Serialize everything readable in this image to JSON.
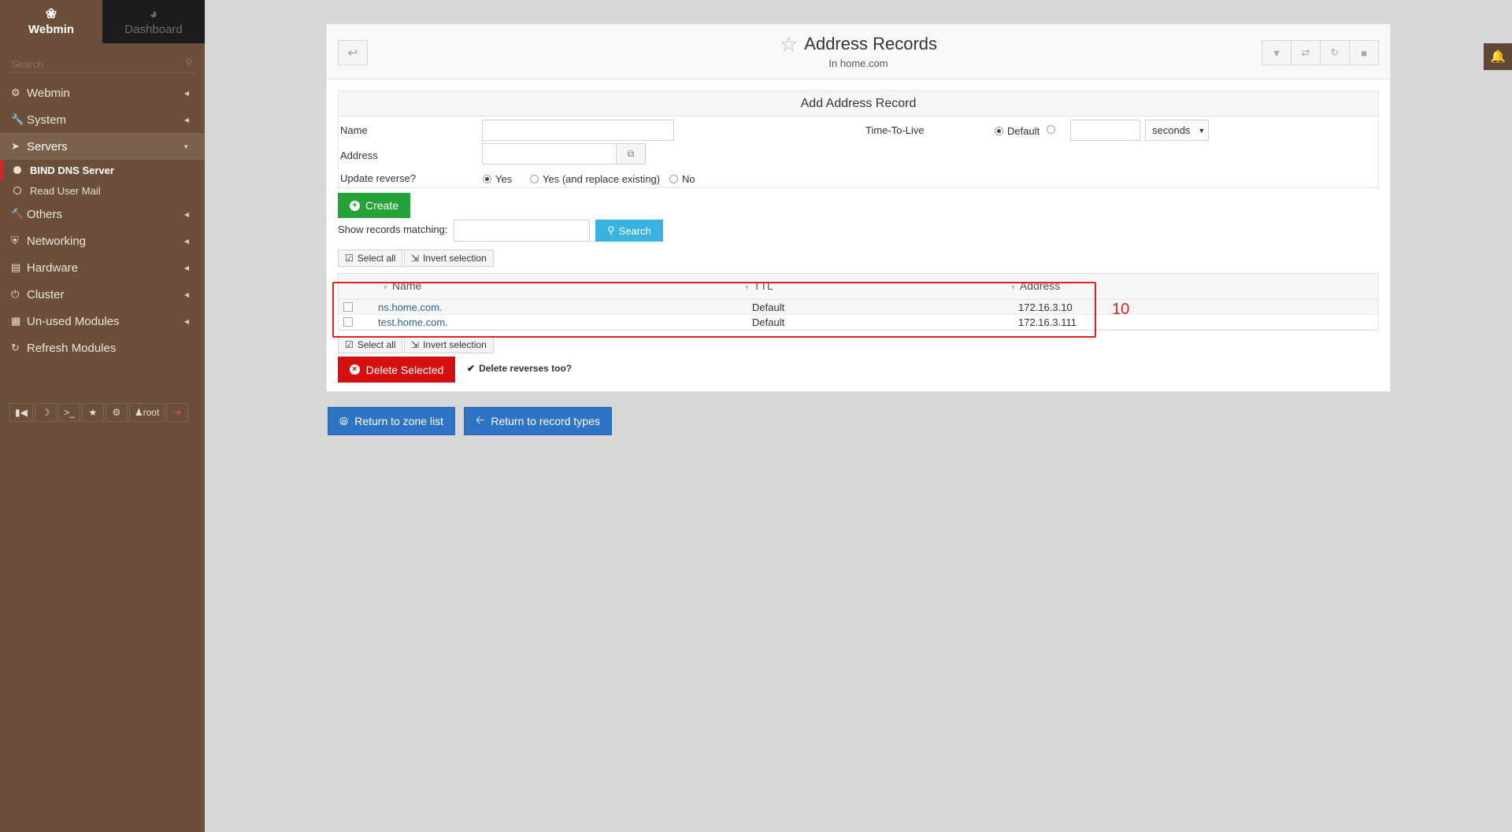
{
  "sidebar": {
    "tabs": [
      {
        "label": "Webmin",
        "icon": "webmin-logo-icon"
      },
      {
        "label": "Dashboard",
        "icon": "dashboard-icon"
      }
    ],
    "search_placeholder": "Search",
    "menu": [
      {
        "label": "Webmin",
        "icon": "gear-icon"
      },
      {
        "label": "System",
        "icon": "wrench-icon"
      },
      {
        "label": "Servers",
        "icon": "rocket-icon"
      },
      {
        "label": "Others",
        "icon": "wrench-icon"
      },
      {
        "label": "Networking",
        "icon": "shield-icon"
      },
      {
        "label": "Hardware",
        "icon": "hard-drive-icon"
      },
      {
        "label": "Cluster",
        "icon": "power-icon"
      },
      {
        "label": "Un-used Modules",
        "icon": "puzzle-icon"
      },
      {
        "label": "Refresh Modules",
        "icon": "refresh-icon"
      }
    ],
    "servers_sub": [
      {
        "label": "BIND DNS Server"
      },
      {
        "label": "Read User Mail"
      }
    ],
    "bottom_user": "root"
  },
  "header": {
    "title": "Address Records",
    "subtitle": "In home.com"
  },
  "form": {
    "caption": "Add Address Record",
    "name_label": "Name",
    "address_label": "Address",
    "update_reverse_label": "Update reverse?",
    "ttl_label": "Time-To-Live",
    "ttl_default": "Default",
    "ttl_unit": "seconds",
    "reverse_options": [
      "Yes",
      "Yes (and replace existing)",
      "No"
    ],
    "create_label": "Create"
  },
  "search": {
    "label": "Show records matching:",
    "button": "Search"
  },
  "selection": {
    "select_all": "Select all",
    "invert": "Invert selection"
  },
  "table": {
    "columns": [
      "Name",
      "TTL",
      "Address"
    ],
    "rows": [
      {
        "name": "ns.home.com.",
        "ttl": "Default",
        "address": "172.16.3.10"
      },
      {
        "name": "test.home.com.",
        "ttl": "Default",
        "address": "172.16.3.111"
      }
    ]
  },
  "annotation_number": "10",
  "delete": {
    "button": "Delete Selected",
    "reverse_check": "Delete reverses too?"
  },
  "nav": {
    "zone_list": "Return to zone list",
    "record_types": "Return to record types"
  },
  "colors": {
    "sidebar": "#6b4f3a",
    "create": "#26a23a",
    "delete": "#d50f0f",
    "search": "#3bb3e0",
    "nav": "#2d74c4",
    "highlight": "#e02020"
  }
}
